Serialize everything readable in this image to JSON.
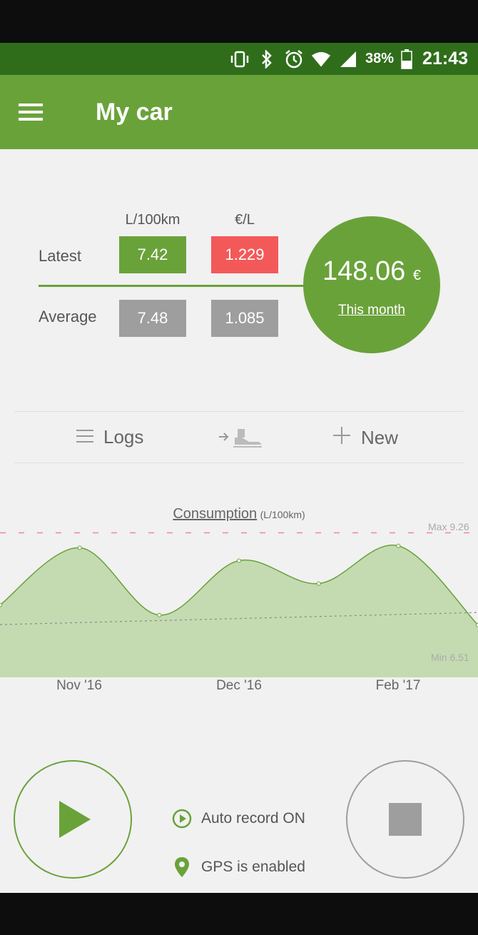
{
  "status_bar": {
    "battery": "38%",
    "time": "21:43"
  },
  "app_bar": {
    "title": "My car"
  },
  "stats": {
    "columns": [
      "L/100km",
      "€/L"
    ],
    "rows": [
      {
        "label": "Latest",
        "values": [
          "7.42",
          "1.229"
        ]
      },
      {
        "label": "Average",
        "values": [
          "7.48",
          "1.085"
        ]
      }
    ],
    "total": {
      "amount": "148.06",
      "currency": "€",
      "period": "This month"
    }
  },
  "actions": {
    "logs": "Logs",
    "new": "New"
  },
  "chart_data": {
    "type": "area",
    "title": "Consumption",
    "unit": "(L/100km)",
    "x_labels": [
      "Nov '16",
      "Dec '16",
      "Feb '17"
    ],
    "values": [
      7.74,
      8.94,
      7.53,
      8.67,
      8.19,
      8.98,
      7.32
    ],
    "average": 7.48,
    "max_label": "Max 9.26",
    "min_label": "Min 6.51",
    "ylim": [
      6.51,
      9.26
    ]
  },
  "controls": {
    "auto_record": "Auto record ON",
    "gps": "GPS is enabled"
  },
  "colors": {
    "primary": "#6aa23a",
    "primary_dark": "#2f6d1b",
    "accent_red": "#f4595a",
    "gray": "#9e9e9e"
  }
}
